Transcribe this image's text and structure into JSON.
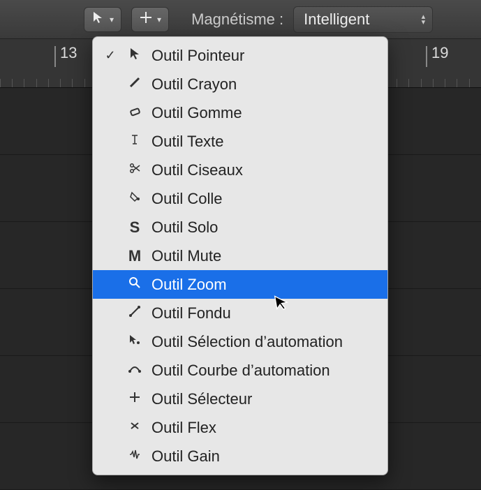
{
  "toolbar": {
    "tool1_icon": "pointer",
    "tool2_icon": "crosshair",
    "snap_label": "Magnétisme :",
    "snap_value": "Intelligent"
  },
  "ruler": {
    "marks": [
      {
        "pos": 78,
        "label": "13"
      },
      {
        "pos": 610,
        "label": "19"
      }
    ]
  },
  "menu": {
    "items": [
      {
        "checked": true,
        "icon": "pointer",
        "label": "Outil Pointeur",
        "highlight": false
      },
      {
        "checked": false,
        "icon": "pencil",
        "label": "Outil Crayon",
        "highlight": false
      },
      {
        "checked": false,
        "icon": "eraser",
        "label": "Outil Gomme",
        "highlight": false
      },
      {
        "checked": false,
        "icon": "text",
        "label": "Outil Texte",
        "highlight": false
      },
      {
        "checked": false,
        "icon": "scissors",
        "label": "Outil Ciseaux",
        "highlight": false
      },
      {
        "checked": false,
        "icon": "glue",
        "label": "Outil Colle",
        "highlight": false
      },
      {
        "checked": false,
        "icon": "solo",
        "label": "Outil Solo",
        "highlight": false
      },
      {
        "checked": false,
        "icon": "mute",
        "label": "Outil Mute",
        "highlight": false
      },
      {
        "checked": false,
        "icon": "zoom",
        "label": "Outil Zoom",
        "highlight": true
      },
      {
        "checked": false,
        "icon": "fade",
        "label": "Outil Fondu",
        "highlight": false
      },
      {
        "checked": false,
        "icon": "autosel",
        "label": "Outil Sélection d’automation",
        "highlight": false
      },
      {
        "checked": false,
        "icon": "autocurve",
        "label": "Outil Courbe d’automation",
        "highlight": false
      },
      {
        "checked": false,
        "icon": "marquee",
        "label": "Outil Sélecteur",
        "highlight": false
      },
      {
        "checked": false,
        "icon": "flex",
        "label": "Outil Flex",
        "highlight": false
      },
      {
        "checked": false,
        "icon": "gain",
        "label": "Outil Gain",
        "highlight": false
      }
    ]
  }
}
